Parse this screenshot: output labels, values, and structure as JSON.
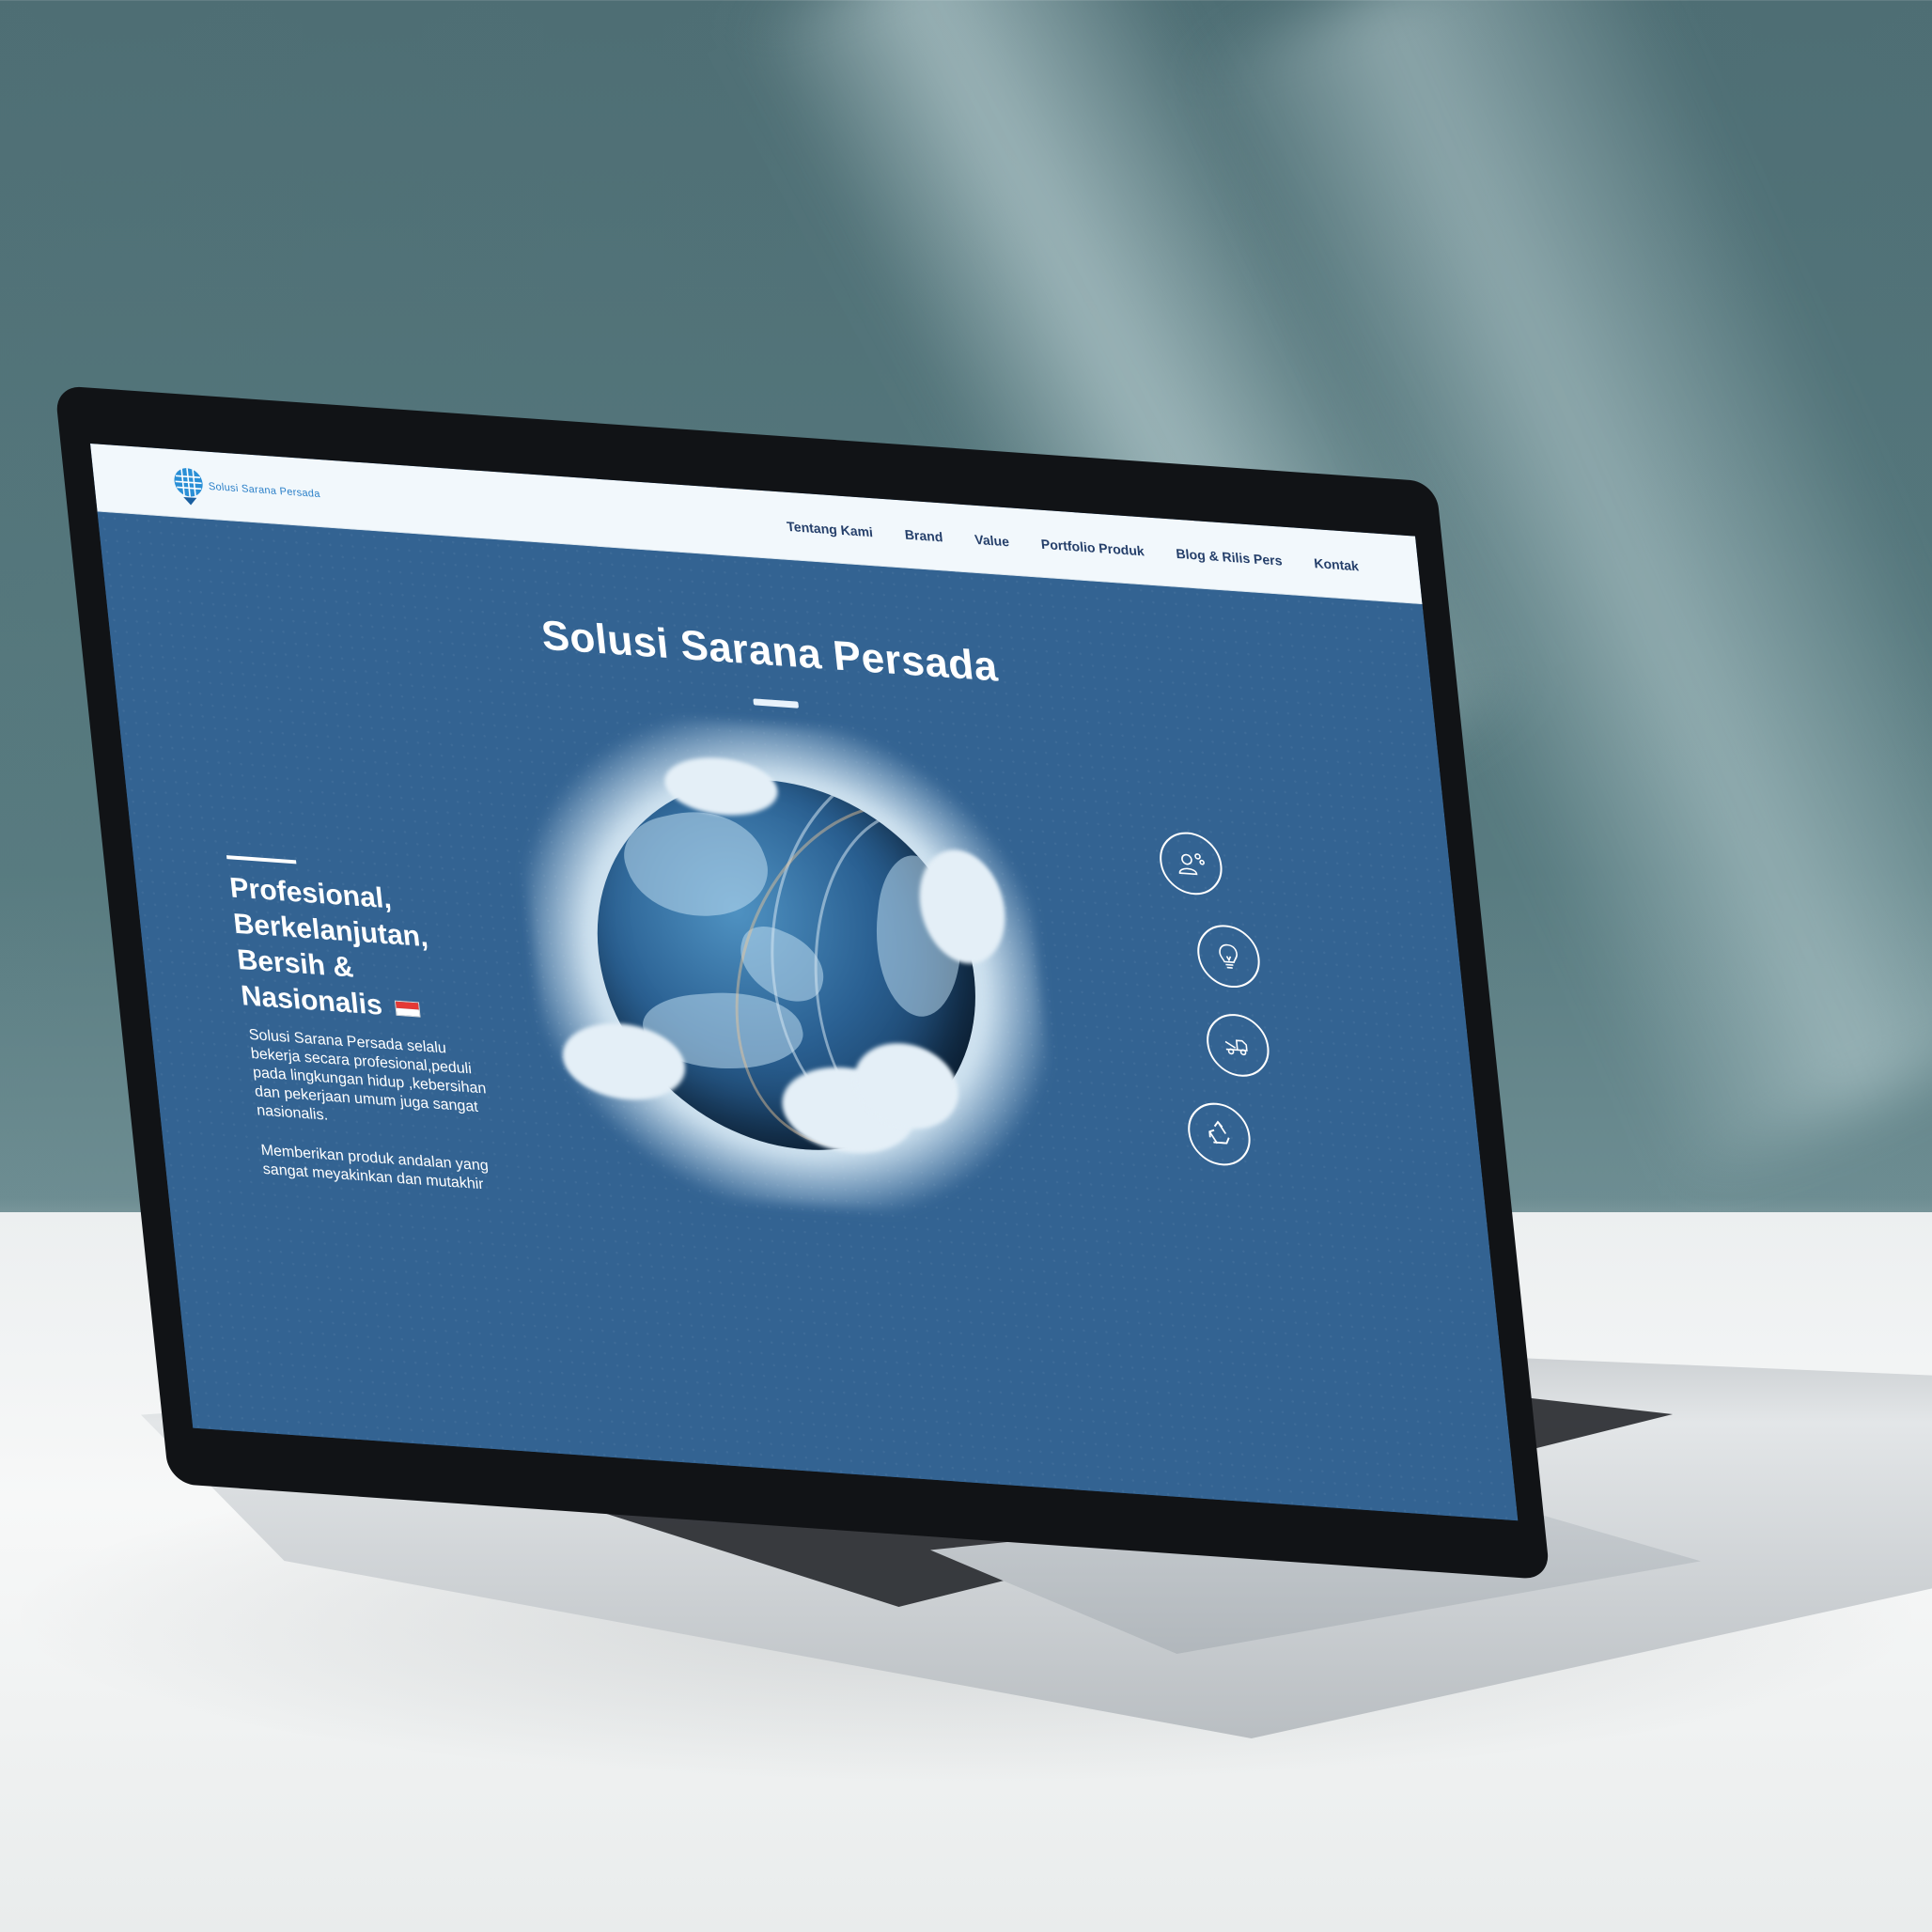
{
  "header": {
    "logo_text": "Solusi Sarana Persada",
    "nav": [
      "Tentang Kami",
      "Brand",
      "Value",
      "Portfolio Produk",
      "Blog & Rilis Pers",
      "Kontak"
    ]
  },
  "hero": {
    "title": "Solusi Sarana Persada",
    "tagline_lines": [
      "Profesional,",
      "Berkelanjutan,",
      "Bersih &",
      "Nasionalis"
    ],
    "paragraph_1": "Solusi Sarana Persada selalu bekerja secara profesional,peduli pada lingkungan hidup ,kebersihan dan pekerjaan umum juga sangat nasionalis.",
    "paragraph_2": "Memberikan produk andalan yang sangat meyakinkan dan mutakhir",
    "feature_icons": [
      "worker-ideas-icon",
      "lightbulb-icon",
      "tow-truck-icon",
      "recycle-icon"
    ]
  },
  "colors": {
    "hero_background": "#336392",
    "header_background": "#f2f8fc",
    "nav_text": "#253f6a",
    "logo_blue": "#2a7fc8",
    "flag_red": "#e53935"
  }
}
